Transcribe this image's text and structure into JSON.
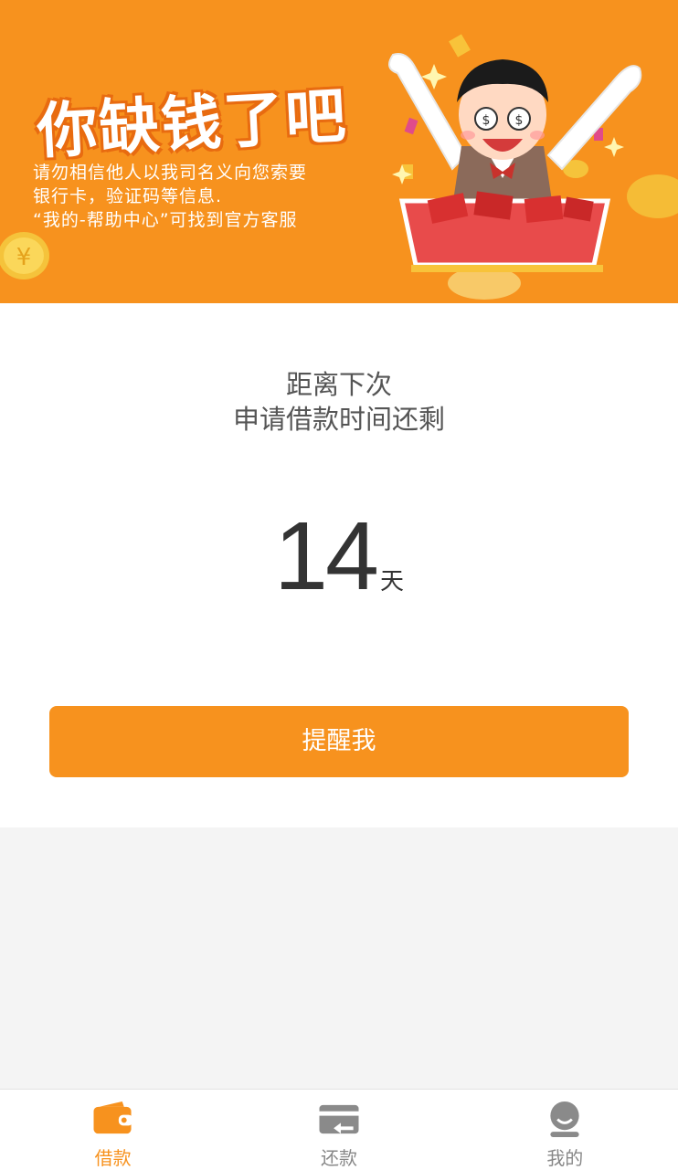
{
  "banner": {
    "headline": "你缺钱了吧",
    "notice_lines": [
      "请勿相信他人以我司名义向您索要",
      "银行卡，验证码等信息.",
      "“我的-帮助中心”可找到官方客服"
    ]
  },
  "countdown": {
    "caption_line1": "距离下次",
    "caption_line2": "申请借款时间还剩",
    "value": "14",
    "unit": "天"
  },
  "actions": {
    "remind_label": "提醒我"
  },
  "tabbar": {
    "tabs": [
      {
        "label": "借款",
        "icon": "wallet-icon",
        "active": true
      },
      {
        "label": "还款",
        "icon": "card-return-icon",
        "active": false
      },
      {
        "label": "我的",
        "icon": "user-icon",
        "active": false
      }
    ]
  },
  "colors": {
    "brand": "#f7921e",
    "inactive": "#888888",
    "page_bg": "#f4f4f4"
  }
}
